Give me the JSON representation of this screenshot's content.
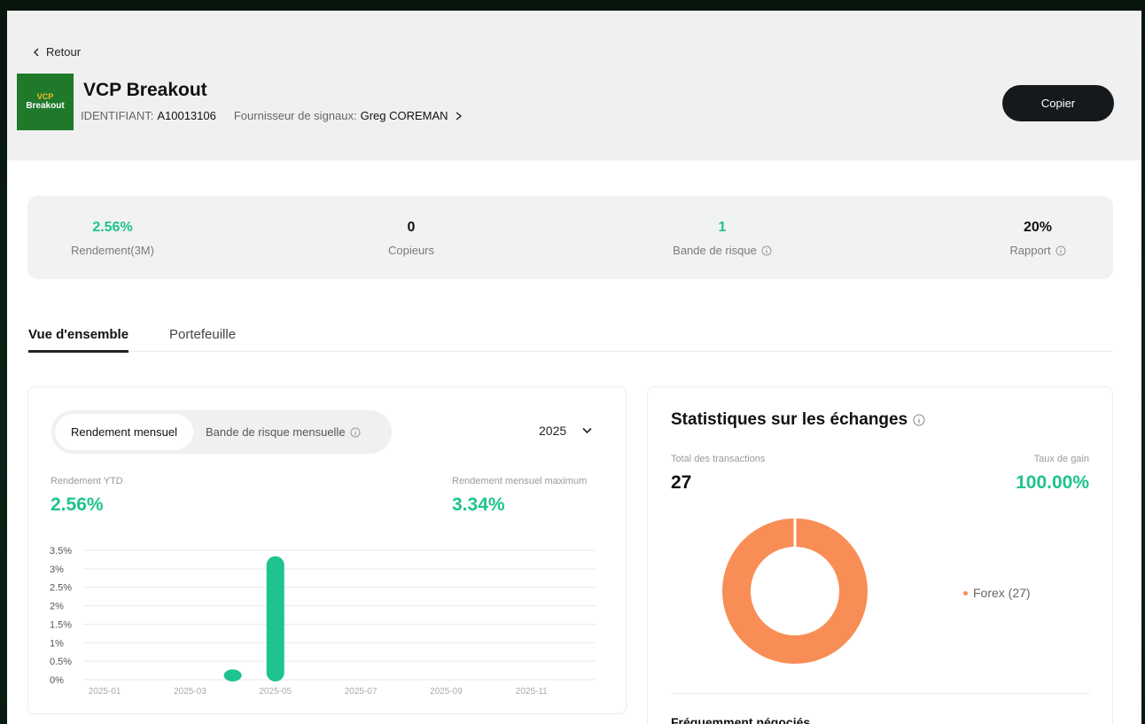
{
  "header": {
    "back_label": "Retour",
    "logo_line1": "VCP",
    "logo_line2": "Breakout",
    "title": "VCP Breakout",
    "id_label": "IDENTIFIANT:",
    "id_value": "A10013106",
    "provider_label": "Fournisseur de signaux:",
    "provider_value": "Greg COREMAN",
    "copy_button": "Copier"
  },
  "stats": [
    {
      "value": "2.56%",
      "label": "Rendement(3M)",
      "accent": true,
      "info": false
    },
    {
      "value": "0",
      "label": "Copieurs",
      "accent": false,
      "info": false
    },
    {
      "value": "1",
      "label": "Bande de risque",
      "accent": true,
      "info": true
    },
    {
      "value": "20%",
      "label": "Rapport",
      "accent": false,
      "info": true
    }
  ],
  "tabs": {
    "overview": "Vue d'ensemble",
    "portfolio": "Portefeuille"
  },
  "monthly": {
    "seg_active": "Rendement mensuel",
    "seg_inactive": "Bande de risque mensuelle",
    "year": "2025",
    "ytd_label": "Rendement YTD",
    "ytd_value": "2.56%",
    "max_label": "Rendement mensuel maximum",
    "max_value": "3.34%"
  },
  "chart_data": {
    "type": "bar",
    "y_ticks": [
      "3.5%",
      "3%",
      "2.5%",
      "2%",
      "1.5%",
      "1%",
      "0.5%",
      "0%"
    ],
    "x_ticks": [
      "2025-01",
      "2025-03",
      "2025-05",
      "2025-07",
      "2025-09",
      "2025-11"
    ],
    "categories": [
      "2025-01",
      "2025-02",
      "2025-03",
      "2025-04",
      "2025-05",
      "2025-06",
      "2025-07",
      "2025-08",
      "2025-09",
      "2025-10",
      "2025-11",
      "2025-12"
    ],
    "values": [
      0,
      0,
      0,
      0.28,
      3.34,
      0,
      0,
      0,
      0,
      0,
      0,
      0
    ],
    "ylim": [
      0,
      3.5
    ],
    "bar_color": "#1ec38f"
  },
  "trade_stats": {
    "title": "Statistiques sur les échanges",
    "total_label": "Total des transactions",
    "total_value": "27",
    "win_label": "Taux de gain",
    "win_value": "100.00%",
    "legend": "Forex (27)",
    "donut_color": "#f88e55",
    "frequent_label": "Fréquemment négociés"
  },
  "colors": {
    "accent": "#1ec38f",
    "dark_button": "#15191c"
  }
}
